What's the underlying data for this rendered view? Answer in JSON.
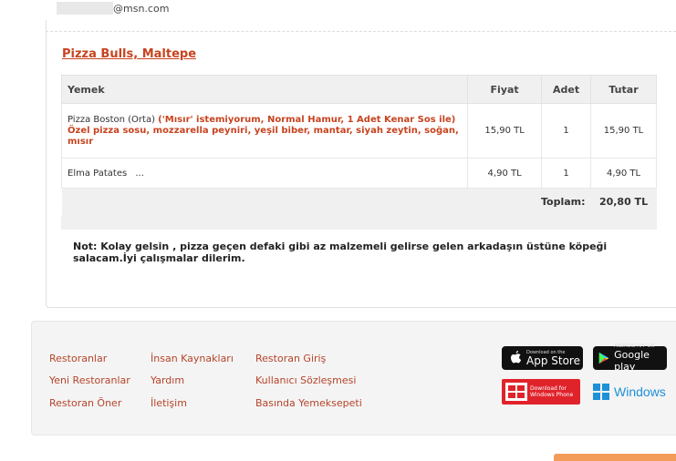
{
  "account": {
    "email_suffix": "@msn.com"
  },
  "restaurant": {
    "name": "Pizza Bulls, Maltepe"
  },
  "table": {
    "headers": {
      "item": "Yemek",
      "price": "Fiyat",
      "qty": "Adet",
      "total": "Tutar"
    },
    "rows": [
      {
        "name": "Pizza Boston (Orta)",
        "options": "('Mısır' istemiyorum, Normal Hamur, 1 Adet Kenar Sos ile)",
        "extras": "Özel pizza sosu, mozzarella peyniri, yeşil biber, mantar, siyah zeytin, soğan, mısır",
        "price": "15,90 TL",
        "qty": "1",
        "total": "15,90 TL"
      },
      {
        "name": "Elma Patates",
        "options": "...",
        "extras": "",
        "price": "4,90 TL",
        "qty": "1",
        "total": "4,90 TL"
      }
    ],
    "total_label": "Toplam:",
    "total_value": "20,80 TL"
  },
  "note": "Not: Kolay gelsin , pizza geçen defaki gibi az malzemeli gelirse gelen arkadaşın üstüne köpeği salacam.İyi çalışmalar dilerim.",
  "footer": {
    "col1": [
      "Restoranlar",
      "Yeni Restoranlar",
      "Restoran Öner"
    ],
    "col2": [
      "İnsan Kaynakları",
      "Yardım",
      "İletişim"
    ],
    "col3": [
      "Restoran Giriş",
      "Kullanıcı Sözleşmesi",
      "Basında Yemeksepeti"
    ],
    "badges": {
      "appstore_small": "Download on the",
      "appstore_big": "App Store",
      "googleplay_small": "ANDROID APP ON",
      "googleplay_big": "Google play",
      "winphone_small": "Download for Windows Phone",
      "windows": "Windows"
    }
  },
  "colors": {
    "accent": "#c8431f",
    "footer_bg": "#f4f4f4",
    "header_bg": "#f0f0f0"
  }
}
